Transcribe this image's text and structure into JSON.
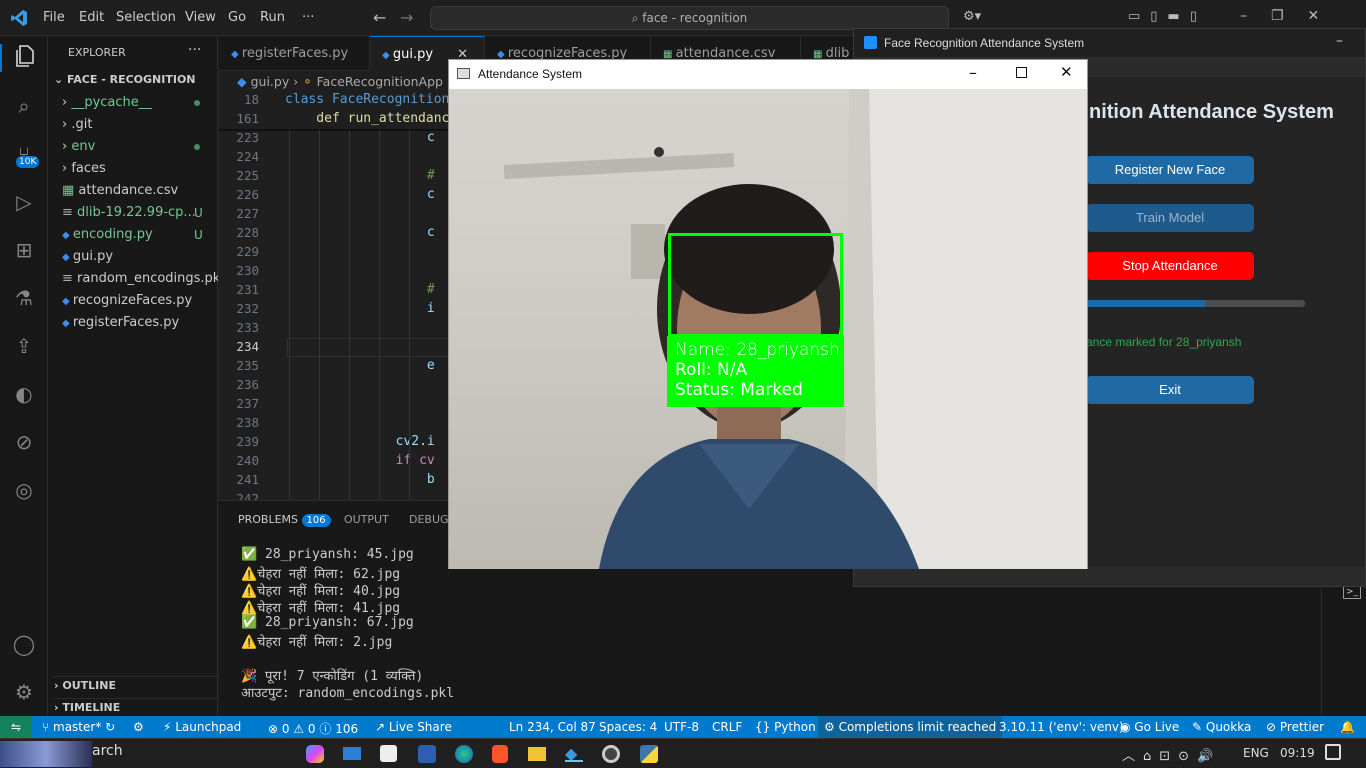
{
  "titlebar": {
    "menu": [
      "File",
      "Edit",
      "Selection",
      "View",
      "Go",
      "Run",
      "···"
    ],
    "search": "face - recognition"
  },
  "activity": {
    "badge": "10K"
  },
  "explorer": {
    "header": "EXPLORER",
    "section": "FACE - RECOGNITION",
    "items": [
      {
        "label": "__pycache__",
        "kind": "folder",
        "color": "#73c991",
        "dot": true
      },
      {
        "label": ".git",
        "kind": "folder",
        "color": "#cccccc"
      },
      {
        "label": "env",
        "kind": "folder",
        "color": "#73c991",
        "dot": true
      },
      {
        "label": "faces",
        "kind": "folder",
        "color": "#cccccc"
      },
      {
        "label": "attendance.csv",
        "kind": "csv",
        "color": "#cccccc"
      },
      {
        "label": "dlib-19.22.99-cp...",
        "kind": "file",
        "color": "#73c991",
        "mark": "U"
      },
      {
        "label": "encoding.py",
        "kind": "py",
        "color": "#73c991",
        "mark": "U"
      },
      {
        "label": "gui.py",
        "kind": "py",
        "color": "#cccccc"
      },
      {
        "label": "random_encodings.pkl",
        "kind": "file",
        "color": "#cccccc"
      },
      {
        "label": "recognizeFaces.py",
        "kind": "py",
        "color": "#cccccc"
      },
      {
        "label": "registerFaces.py",
        "kind": "py",
        "color": "#cccccc"
      }
    ],
    "outline": "OUTLINE",
    "timeline": "TIMELINE"
  },
  "tabs": [
    "registerFaces.py",
    "gui.py",
    "recognizeFaces.py",
    "attendance.csv",
    "dlib"
  ],
  "breadcrumb": {
    "file": "gui.py",
    "symbol": "FaceRecognitionApp"
  },
  "sticky": [
    {
      "ln": "18",
      "code": "class FaceRecognition"
    },
    {
      "ln": "161",
      "code": "    def run_attendanc"
    }
  ],
  "code_lines": [
    {
      "ln": "223",
      "code": "            c"
    },
    {
      "ln": "224",
      "code": ""
    },
    {
      "ln": "225",
      "code": "            #"
    },
    {
      "ln": "226",
      "code": "            c"
    },
    {
      "ln": "227",
      "code": ""
    },
    {
      "ln": "228",
      "code": "            c"
    },
    {
      "ln": "229",
      "code": ""
    },
    {
      "ln": "230",
      "code": ""
    },
    {
      "ln": "231",
      "code": "            #"
    },
    {
      "ln": "232",
      "code": "            i"
    },
    {
      "ln": "233",
      "code": ""
    },
    {
      "ln": "234",
      "code": ""
    },
    {
      "ln": "235",
      "code": "            e"
    },
    {
      "ln": "236",
      "code": ""
    },
    {
      "ln": "237",
      "code": ""
    },
    {
      "ln": "238",
      "code": ""
    },
    {
      "ln": "239",
      "code": "        cv2.i"
    },
    {
      "ln": "240",
      "code": "        if cv"
    },
    {
      "ln": "241",
      "code": "            b"
    },
    {
      "ln": "242",
      "code": ""
    }
  ],
  "panel": {
    "tabs": [
      "PROBLEMS",
      "OUTPUT",
      "DEBUG"
    ],
    "problems_count": "106",
    "lines": [
      "✅ 28_priyansh: 45.jpg",
      "⚠️चेहरा नहीं मिला: 62.jpg",
      "⚠️चेहरा नहीं मिला: 40.jpg",
      "⚠️चेहरा नहीं मिला: 41.jpg",
      "✅ 28_priyansh: 67.jpg",
      "⚠️चेहरा नहीं मिला: 2.jpg",
      "",
      "🎉 पूरा! 7 एन्कोडिंग (1 व्यक्ति)",
      "आउटपुट: random_encodings.pkl"
    ]
  },
  "statusbar": {
    "branch": "master*",
    "launchpad": "Launchpad",
    "errors": "0",
    "warnings": "0",
    "info": "106",
    "liveshare": "Live Share",
    "position": "Ln 234, Col 87",
    "spaces": "Spaces: 4",
    "encoding": "UTF-8",
    "eol": "CRLF",
    "language": "Python",
    "completions": "Completions limit reached",
    "interpreter": "3.10.11 ('env': venv)",
    "golive": "Go Live",
    "quokka": "Quokka",
    "prettier": "Prettier"
  },
  "taskbar": {
    "search": "arch",
    "lang": "ENG",
    "time": "09:19"
  },
  "tk_window": {
    "title": "Face Recognition Attendance System",
    "heading": "nition Attendance System",
    "buttons": {
      "register": "Register New Face",
      "train": "Train Model",
      "stop": "Stop Attendance",
      "exit": "Exit"
    },
    "progress": 0.55,
    "status": "ance marked for 28_priyansh"
  },
  "cv_window": {
    "title": "Attendance System",
    "overlay": {
      "name": "Name: 28_priyansh",
      "roll": "Roll: N/A",
      "status": "Status: Marked"
    }
  },
  "colors": {
    "accent_blue": "#2a6eb8",
    "stop_red": "#ff0000",
    "status_bar": "#007acc",
    "detect_green": "#00ff00"
  }
}
